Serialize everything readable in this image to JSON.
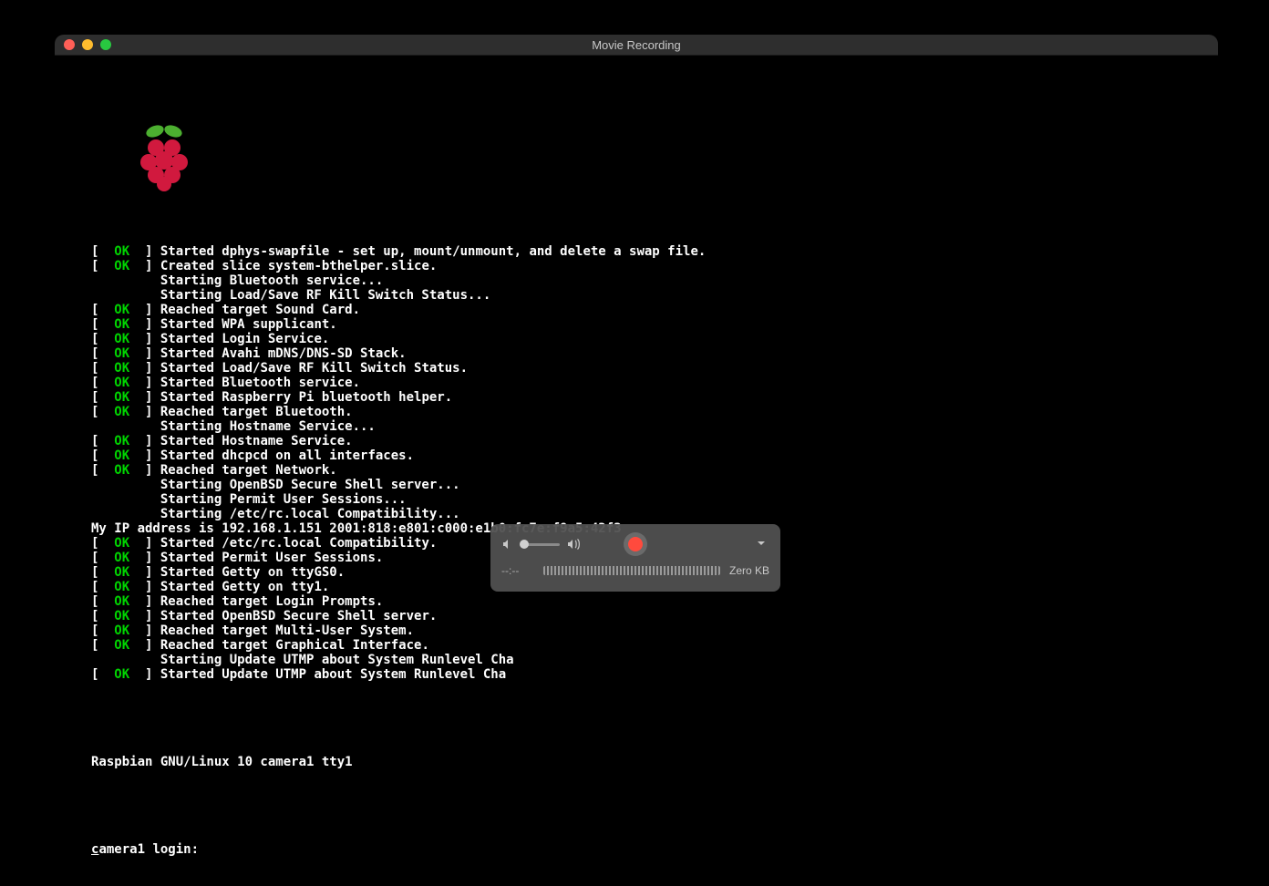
{
  "window": {
    "title": "Movie Recording"
  },
  "boot": {
    "lines": [
      {
        "status": "OK",
        "msg": "Started dphys-swapfile - set up, mount/unmount, and delete a swap file."
      },
      {
        "status": "OK",
        "msg": "Created slice system-bthelper.slice."
      },
      {
        "status": null,
        "msg": "Starting Bluetooth service..."
      },
      {
        "status": null,
        "msg": "Starting Load/Save RF Kill Switch Status..."
      },
      {
        "status": "OK",
        "msg": "Reached target Sound Card."
      },
      {
        "status": "OK",
        "msg": "Started WPA supplicant."
      },
      {
        "status": "OK",
        "msg": "Started Login Service."
      },
      {
        "status": "OK",
        "msg": "Started Avahi mDNS/DNS-SD Stack."
      },
      {
        "status": "OK",
        "msg": "Started Load/Save RF Kill Switch Status."
      },
      {
        "status": "OK",
        "msg": "Started Bluetooth service."
      },
      {
        "status": "OK",
        "msg": "Started Raspberry Pi bluetooth helper."
      },
      {
        "status": "OK",
        "msg": "Reached target Bluetooth."
      },
      {
        "status": null,
        "msg": "Starting Hostname Service..."
      },
      {
        "status": "OK",
        "msg": "Started Hostname Service."
      },
      {
        "status": "OK",
        "msg": "Started dhcpcd on all interfaces."
      },
      {
        "status": "OK",
        "msg": "Reached target Network."
      },
      {
        "status": null,
        "msg": "Starting OpenBSD Secure Shell server..."
      },
      {
        "status": null,
        "msg": "Starting Permit User Sessions..."
      },
      {
        "status": null,
        "msg": "Starting /etc/rc.local Compatibility..."
      },
      {
        "raw": "My IP address is 192.168.1.151 2001:818:e801:c000:e1b0:fc7e:f9a5:42f3"
      },
      {
        "status": "OK",
        "msg": "Started /etc/rc.local Compatibility."
      },
      {
        "status": "OK",
        "msg": "Started Permit User Sessions."
      },
      {
        "status": "OK",
        "msg": "Started Getty on ttyGS0."
      },
      {
        "status": "OK",
        "msg": "Started Getty on tty1."
      },
      {
        "status": "OK",
        "msg": "Reached target Login Prompts."
      },
      {
        "status": "OK",
        "msg": "Started OpenBSD Secure Shell server."
      },
      {
        "status": "OK",
        "msg": "Reached target Multi-User System."
      },
      {
        "status": "OK",
        "msg": "Reached target Graphical Interface."
      },
      {
        "status": null,
        "msg": "Starting Update UTMP about System Runlevel Cha"
      },
      {
        "status": "OK",
        "msg": "Started Update UTMP about System Runlevel Cha"
      }
    ],
    "banner": "Raspbian GNU/Linux 10 camera1 tty1",
    "login_host": "camera1",
    "login_suffix": " login:"
  },
  "recorder": {
    "time": "--:--",
    "filesize": "Zero KB"
  }
}
